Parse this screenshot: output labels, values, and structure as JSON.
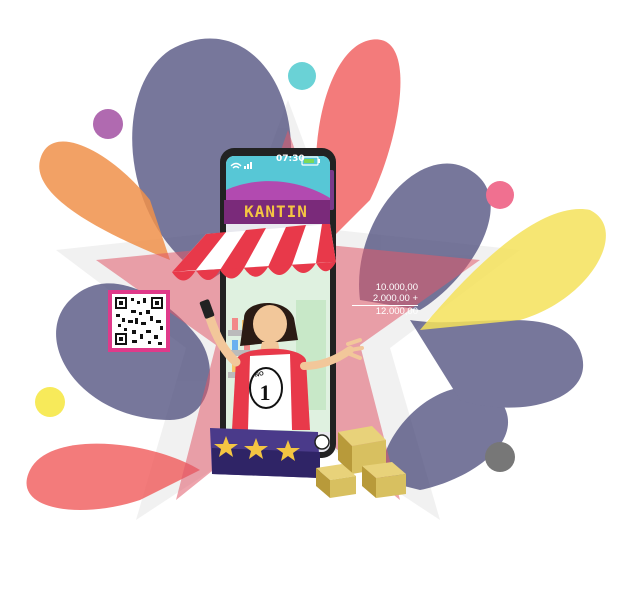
{
  "phone": {
    "time": "07:30"
  },
  "store": {
    "sign": "KANTIN"
  },
  "calculation": {
    "line1": "10.000,00",
    "line2": "2.000,00 +",
    "total": "12.000,00"
  },
  "badge": {
    "top_text": "NO",
    "number": "1"
  },
  "colors": {
    "star": "#e05a6a",
    "splash_dark": "#4a4a7a",
    "splash_red": "#f05a5a",
    "splash_yellow": "#f5e25a",
    "phone_body": "#222222",
    "screen_top": "#57c7d6",
    "awning_red": "#e8394a",
    "platform_purple": "#4a3a8a",
    "box": "#d8c060"
  },
  "icons": {
    "qr_code": "qr-code-icon",
    "wifi": "wifi-icon",
    "signal": "signal-icon",
    "battery": "battery-icon",
    "stars": "star-icon",
    "boxes": "package-box-icon"
  }
}
